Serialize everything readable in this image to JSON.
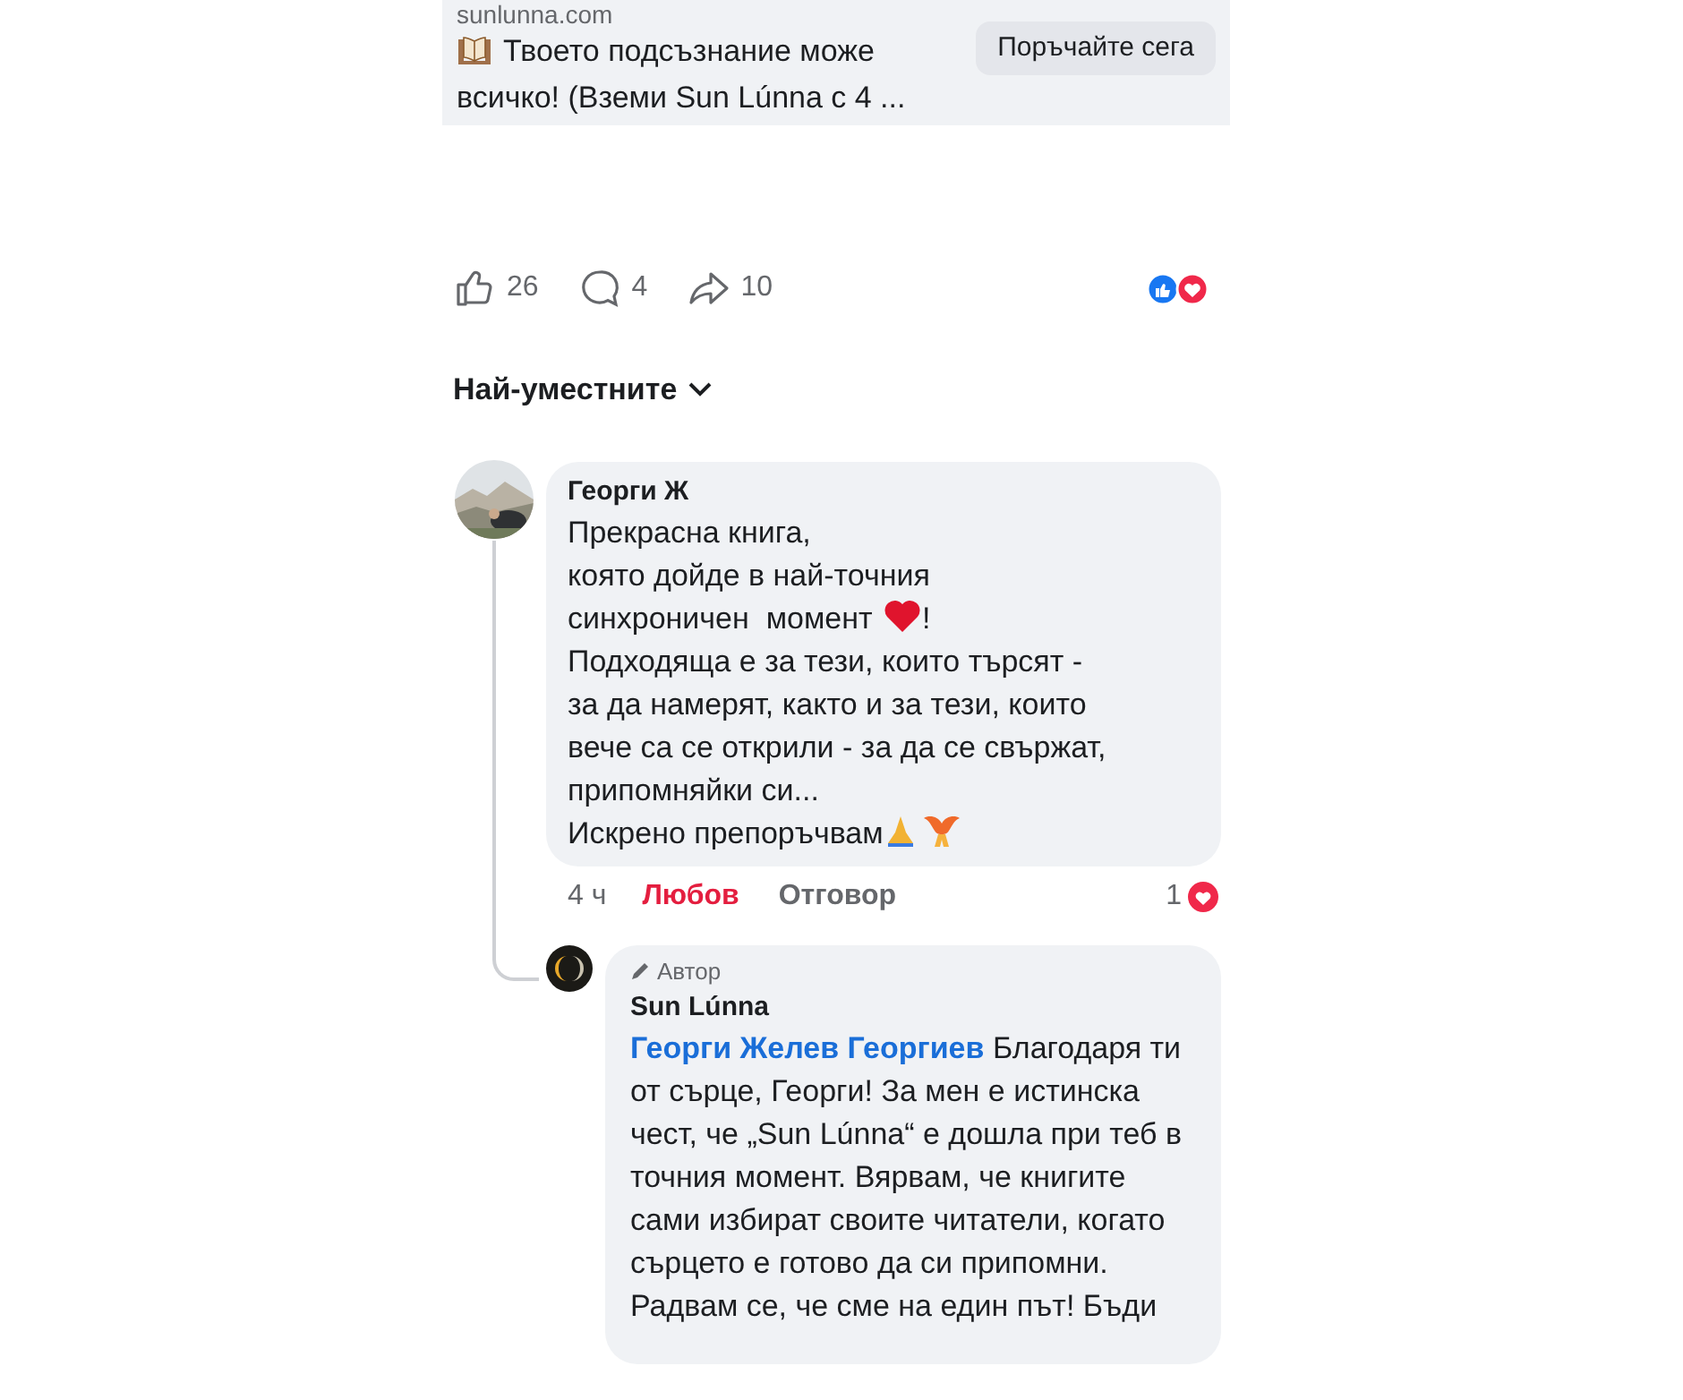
{
  "ad": {
    "domain": "sunlunna.com",
    "title": "Твоето подсъзнание може всичко! (Вземи Sun Lúnna с 4 ...",
    "button": "Поръчайте сега"
  },
  "actions": [
    {
      "kind": "like",
      "count": "26"
    },
    {
      "kind": "comment",
      "count": "4"
    },
    {
      "kind": "share",
      "count": "10"
    }
  ],
  "sort": {
    "label": "Най-уместните"
  },
  "comment": {
    "author": "Георги Ж",
    "lines": [
      [
        {
          "kind": "text",
          "text": "Прекрасна книга,"
        }
      ],
      [
        {
          "kind": "text",
          "text": "която дойде в най-точния"
        }
      ],
      [
        {
          "kind": "text",
          "text": "синхроничен  момент "
        },
        {
          "kind": "heart"
        },
        {
          "kind": "text",
          "text": "!"
        }
      ],
      [
        {
          "kind": "text",
          "text": "Подходяща е за тези, които търсят -"
        }
      ],
      [
        {
          "kind": "text",
          "text": "за да намерят, както и за тези, които"
        }
      ],
      [
        {
          "kind": "text",
          "text": "вече са се открили - за да се свържат,"
        }
      ],
      [
        {
          "kind": "text",
          "text": "припомняйки си..."
        }
      ],
      [
        {
          "kind": "text",
          "text": "Искрено препоръчвам"
        },
        {
          "kind": "pray"
        },
        {
          "kind": "phoenix"
        }
      ]
    ],
    "time": "4 ч",
    "reaction": {
      "label": "Любов",
      "selected": true
    },
    "reply": "Отговор",
    "reaction_count": "1"
  },
  "reply": {
    "badge": "Автор",
    "author": "Sun Lúnna",
    "mention": "Георги Желев Георгиев",
    "text": " Благодаря ти от сърце, Георги! За мен е истинска чест, че „Sun Lúnna“ е дошла при теб в точния момент. Вярвам, че книгите сами избират своите читатели, когато сърцето е готово да си припомни. Радвам се, че сме на един път! Бъди"
  }
}
